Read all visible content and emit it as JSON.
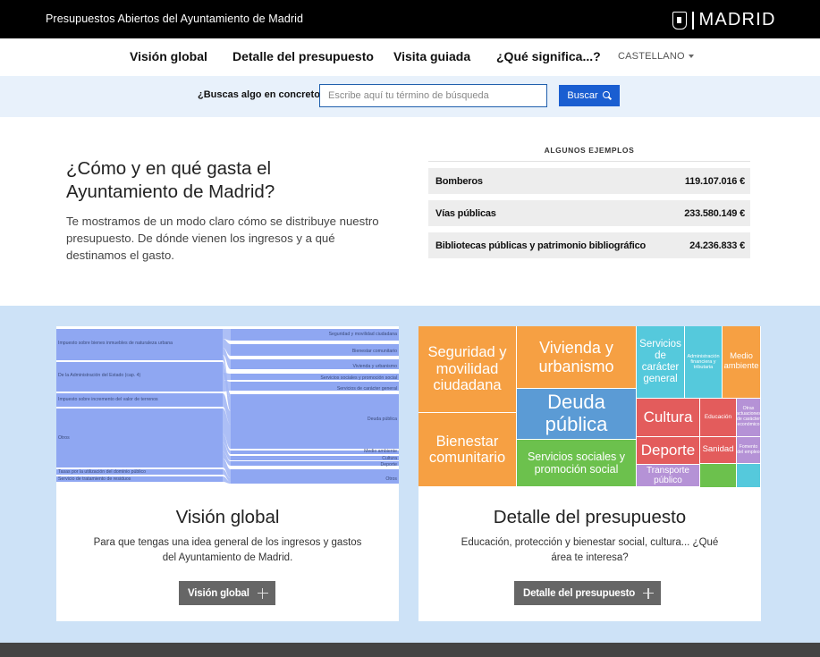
{
  "header": {
    "site_title": "Presupuestos Abiertos del Ayuntamiento de Madrid",
    "logo_text": "MADRID"
  },
  "nav": {
    "items": [
      "Visión global",
      "Detalle del presupuesto",
      "Visita guiada",
      "¿Qué significa...?"
    ],
    "language": "CASTELLANO"
  },
  "search": {
    "label": "¿Buscas algo en concreto?",
    "placeholder": "Escribe aquí tu término de búsqueda",
    "button": "Buscar"
  },
  "intro": {
    "title": "¿Cómo y en qué gasta el Ayuntamiento de Madrid?",
    "text": "Te mostramos de un modo claro cómo se distribuye nuestro presupuesto. De dónde vienen los ingresos y a qué destinamos el gasto."
  },
  "examples": {
    "title": "ALGUNOS EJEMPLOS",
    "rows": [
      {
        "label": "Bomberos",
        "value": "119.107.016 €"
      },
      {
        "label": "Vías públicas",
        "value": "233.580.149 €"
      },
      {
        "label": "Bibliotecas públicas y patrimonio bibliográfico",
        "value": "24.236.833 €"
      }
    ]
  },
  "cards": {
    "global": {
      "title": "Visión global",
      "text": "Para que tengas una idea general de los ingresos y gastos del Ayuntamiento de Madrid.",
      "button": "Visión global",
      "sankey": {
        "left_labels": [
          "Impuesto sobre bienes inmuebles de naturaleza urbana",
          "De la Administración del Estado (cap. 4)",
          "Impuesto sobre incremento del valor de terrenos",
          "Otros",
          "Tasas por la utilización del dominio público",
          "Servicio de tratamiento de residuos"
        ],
        "right_labels": [
          "Seguridad y movilidad ciudadana",
          "Bienestar comunitario",
          "Vivienda y urbanismo",
          "Servicios sociales y promoción social",
          "Servicios de carácter general",
          "Deuda pública",
          "Medio ambiente",
          "Cultura",
          "Deporte",
          "Otros"
        ],
        "colors": {
          "flow": "#9fb4f5",
          "flow_dark": "#8fa7f2"
        }
      }
    },
    "detail": {
      "title": "Detalle del presupuesto",
      "text": "Educación, protección y bienestar social, cultura... ¿Qué área te interesa?",
      "button": "Detalle del presupuesto",
      "treemap": {
        "tiles": [
          {
            "label": "Seguridad y movilidad ciudadana",
            "color": "#f6a043"
          },
          {
            "label": "Bienestar comunitario",
            "color": "#f6a043"
          },
          {
            "label": "Vivienda y urbanismo",
            "color": "#f6a043"
          },
          {
            "label": "Deuda pública",
            "color": "#5b9bd5"
          },
          {
            "label": "Servicios sociales y promoción social",
            "color": "#6cc14d"
          },
          {
            "label": "Servicios de carácter general",
            "color": "#55c9dc"
          },
          {
            "label": "Administración financiera y tributaria",
            "color": "#55c9dc"
          },
          {
            "label": "Medio ambiente",
            "color": "#f6a043"
          },
          {
            "label": "Cultura",
            "color": "#e35c5c"
          },
          {
            "label": "Educación",
            "color": "#e35c5c"
          },
          {
            "label": "Otras actuaciones de carácter económico",
            "color": "#b592d6"
          },
          {
            "label": "Deporte",
            "color": "#e35c5c"
          },
          {
            "label": "Sanidad",
            "color": "#e35c5c"
          },
          {
            "label": "Fomento del empleo",
            "color": "#b592d6"
          },
          {
            "label": "Transporte público",
            "color": "#b592d6"
          }
        ]
      }
    }
  }
}
